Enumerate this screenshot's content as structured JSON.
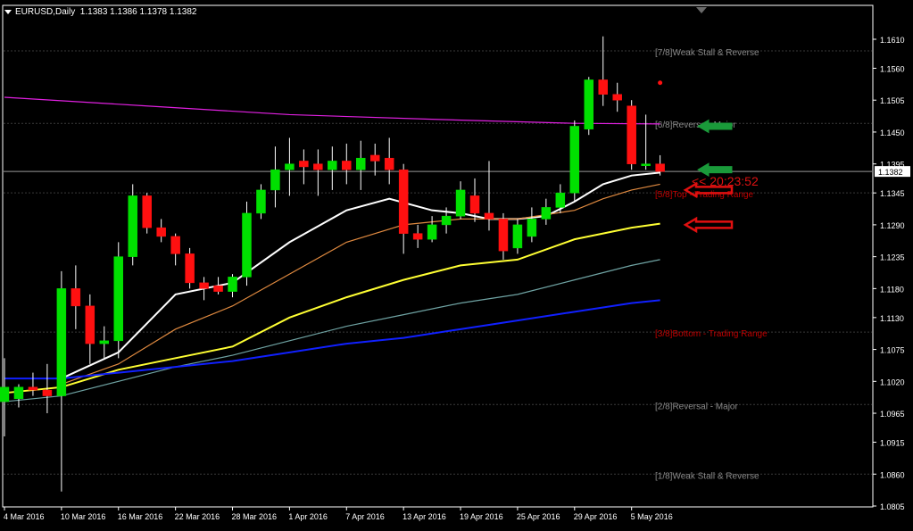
{
  "header": {
    "symbol": "EURUSD,Daily",
    "ohlc": "1.1383 1.1386 1.1378 1.1382"
  },
  "colors": {
    "background": "#000000",
    "frame": "#ffffff",
    "bull_candle": "#00e000",
    "bear_candle": "#ff1010",
    "wick": "#ffffff",
    "ema_white": "#ffffff",
    "ema_orange": "#e08a40",
    "ema_yellow": "#ffff33",
    "ema_teal": "#6fa3a3",
    "ema_blue": "#1020ff",
    "ema_magenta": "#e020e0",
    "murrey_line": "#3a3a3a",
    "murrey_text_grey": "#8a8a8a",
    "murrey_text_red": "#c00000",
    "price_line": "#9a9a9a",
    "arrow_green": "#1a9a3a",
    "arrow_red": "#e01010",
    "countdown": "#dd1111"
  },
  "chart_data": {
    "type": "candlestick",
    "symbol": "EURUSD",
    "timeframe": "Daily",
    "ylim": [
      1.08,
      1.164
    ],
    "y_ticks": [
      "1.1610",
      "1.1560",
      "1.1505",
      "1.1450",
      "1.1395",
      "1.1345",
      "1.1290",
      "1.1235",
      "1.1180",
      "1.1130",
      "1.1075",
      "1.1020",
      "1.0965",
      "1.0915",
      "1.0860",
      "1.0805"
    ],
    "x_tick_labels": [
      "4 Mar 2016",
      "10 Mar 2016",
      "16 Mar 2016",
      "22 Mar 2016",
      "28 Mar 2016",
      "1 Apr 2016",
      "7 Apr 2016",
      "13 Apr 2016",
      "19 Apr 2016",
      "25 Apr 2016",
      "29 Apr 2016",
      "5 May 2016"
    ],
    "x_tick_index": [
      0,
      4,
      8,
      12,
      16,
      20,
      24,
      28,
      32,
      36,
      40,
      44
    ],
    "candles": [
      {
        "o": 1.0985,
        "h": 1.106,
        "l": 1.0925,
        "c": 1.101
      },
      {
        "o": 1.099,
        "h": 1.1015,
        "l": 1.0975,
        "c": 1.101
      },
      {
        "o": 1.101,
        "h": 1.1035,
        "l": 1.0995,
        "c": 1.1005
      },
      {
        "o": 1.1005,
        "h": 1.105,
        "l": 1.0965,
        "c": 1.0995
      },
      {
        "o": 1.0995,
        "h": 1.121,
        "l": 1.083,
        "c": 1.118
      },
      {
        "o": 1.118,
        "h": 1.122,
        "l": 1.111,
        "c": 1.115
      },
      {
        "o": 1.115,
        "h": 1.117,
        "l": 1.105,
        "c": 1.1085
      },
      {
        "o": 1.1085,
        "h": 1.1115,
        "l": 1.106,
        "c": 1.109
      },
      {
        "o": 1.109,
        "h": 1.126,
        "l": 1.106,
        "c": 1.1235
      },
      {
        "o": 1.1235,
        "h": 1.136,
        "l": 1.122,
        "c": 1.134
      },
      {
        "o": 1.134,
        "h": 1.1345,
        "l": 1.1275,
        "c": 1.1285
      },
      {
        "o": 1.1285,
        "h": 1.13,
        "l": 1.126,
        "c": 1.127
      },
      {
        "o": 1.127,
        "h": 1.1275,
        "l": 1.122,
        "c": 1.124
      },
      {
        "o": 1.124,
        "h": 1.125,
        "l": 1.118,
        "c": 1.119
      },
      {
        "o": 1.119,
        "h": 1.12,
        "l": 1.116,
        "c": 1.118
      },
      {
        "o": 1.1185,
        "h": 1.12,
        "l": 1.117,
        "c": 1.1175
      },
      {
        "o": 1.1175,
        "h": 1.1205,
        "l": 1.1165,
        "c": 1.12
      },
      {
        "o": 1.12,
        "h": 1.133,
        "l": 1.1185,
        "c": 1.131
      },
      {
        "o": 1.131,
        "h": 1.136,
        "l": 1.13,
        "c": 1.135
      },
      {
        "o": 1.135,
        "h": 1.1425,
        "l": 1.132,
        "c": 1.1385
      },
      {
        "o": 1.1385,
        "h": 1.144,
        "l": 1.134,
        "c": 1.1395
      },
      {
        "o": 1.14,
        "h": 1.142,
        "l": 1.136,
        "c": 1.139
      },
      {
        "o": 1.1395,
        "h": 1.142,
        "l": 1.134,
        "c": 1.1385
      },
      {
        "o": 1.1385,
        "h": 1.1425,
        "l": 1.135,
        "c": 1.14
      },
      {
        "o": 1.14,
        "h": 1.143,
        "l": 1.136,
        "c": 1.1385
      },
      {
        "o": 1.1385,
        "h": 1.1435,
        "l": 1.135,
        "c": 1.1405
      },
      {
        "o": 1.141,
        "h": 1.143,
        "l": 1.1375,
        "c": 1.14
      },
      {
        "o": 1.1405,
        "h": 1.144,
        "l": 1.136,
        "c": 1.1385
      },
      {
        "o": 1.1385,
        "h": 1.1395,
        "l": 1.124,
        "c": 1.1275
      },
      {
        "o": 1.1275,
        "h": 1.129,
        "l": 1.125,
        "c": 1.1265
      },
      {
        "o": 1.1265,
        "h": 1.1305,
        "l": 1.126,
        "c": 1.129
      },
      {
        "o": 1.129,
        "h": 1.132,
        "l": 1.1275,
        "c": 1.1305
      },
      {
        "o": 1.1305,
        "h": 1.1365,
        "l": 1.13,
        "c": 1.135
      },
      {
        "o": 1.134,
        "h": 1.137,
        "l": 1.1295,
        "c": 1.131
      },
      {
        "o": 1.131,
        "h": 1.14,
        "l": 1.128,
        "c": 1.13
      },
      {
        "o": 1.13,
        "h": 1.131,
        "l": 1.123,
        "c": 1.1245
      },
      {
        "o": 1.125,
        "h": 1.13,
        "l": 1.124,
        "c": 1.129
      },
      {
        "o": 1.127,
        "h": 1.132,
        "l": 1.126,
        "c": 1.13
      },
      {
        "o": 1.13,
        "h": 1.1335,
        "l": 1.129,
        "c": 1.132
      },
      {
        "o": 1.132,
        "h": 1.136,
        "l": 1.131,
        "c": 1.1345
      },
      {
        "o": 1.1345,
        "h": 1.147,
        "l": 1.133,
        "c": 1.146
      },
      {
        "o": 1.1455,
        "h": 1.1545,
        "l": 1.1445,
        "c": 1.154
      },
      {
        "o": 1.154,
        "h": 1.1615,
        "l": 1.1495,
        "c": 1.1515
      },
      {
        "o": 1.1515,
        "h": 1.1535,
        "l": 1.1485,
        "c": 1.1505
      },
      {
        "o": 1.1495,
        "h": 1.1505,
        "l": 1.1385,
        "c": 1.1395
      },
      {
        "o": 1.1395,
        "h": 1.148,
        "l": 1.1385,
        "c": 1.1395
      },
      {
        "o": 1.1395,
        "h": 1.141,
        "l": 1.1375,
        "c": 1.1382
      }
    ],
    "series": [
      {
        "color": "#e020e0",
        "x": [
          0,
          10,
          20,
          30,
          40,
          46
        ],
        "y": [
          1.151,
          1.1495,
          1.148,
          1.1472,
          1.1465,
          1.1464
        ]
      },
      {
        "color": "#ffffff",
        "x": [
          4,
          8,
          12,
          16,
          20,
          24,
          27,
          30,
          32,
          34,
          36,
          38,
          40,
          42,
          44,
          46
        ],
        "y": [
          1.1025,
          1.107,
          1.117,
          1.119,
          1.126,
          1.1315,
          1.1335,
          1.1315,
          1.131,
          1.13,
          1.13,
          1.1305,
          1.133,
          1.136,
          1.1375,
          1.138
        ]
      },
      {
        "color": "#e08a40",
        "x": [
          4,
          8,
          12,
          16,
          20,
          24,
          28,
          32,
          36,
          40,
          42,
          44,
          46
        ],
        "y": [
          1.1015,
          1.105,
          1.111,
          1.115,
          1.1205,
          1.126,
          1.129,
          1.13,
          1.13,
          1.1315,
          1.1335,
          1.135,
          1.136
        ]
      },
      {
        "color": "#ffff33",
        "x": [
          0,
          4,
          8,
          12,
          16,
          20,
          24,
          28,
          32,
          36,
          40,
          44,
          46
        ],
        "y": [
          1.1,
          1.101,
          1.104,
          1.106,
          1.108,
          1.113,
          1.1165,
          1.1195,
          1.122,
          1.123,
          1.1265,
          1.1285,
          1.1292
        ]
      },
      {
        "color": "#6fa3a3",
        "x": [
          0,
          4,
          8,
          12,
          16,
          20,
          24,
          28,
          32,
          36,
          40,
          44,
          46
        ],
        "y": [
          1.0985,
          1.0995,
          1.102,
          1.1045,
          1.1065,
          1.109,
          1.1115,
          1.1135,
          1.1155,
          1.117,
          1.1195,
          1.122,
          1.123
        ]
      },
      {
        "color": "#1020ff",
        "x": [
          0,
          4,
          8,
          12,
          16,
          20,
          24,
          28,
          32,
          36,
          40,
          44,
          46
        ],
        "y": [
          1.1025,
          1.1025,
          1.1035,
          1.1045,
          1.1055,
          1.107,
          1.1085,
          1.1095,
          1.111,
          1.1125,
          1.114,
          1.1155,
          1.116
        ]
      }
    ],
    "murrey_levels": [
      {
        "label": "[7/8]Weak Stall & Reverse",
        "price": 1.159,
        "color": "#8a8a8a"
      },
      {
        "label": "[6/8]Reverse - Major",
        "price": 1.1465,
        "color": "#8a8a8a"
      },
      {
        "label": "[5/8]Top - Trading Range",
        "price": 1.1345,
        "color": "#c00000"
      },
      {
        "label": "[3/8]Bottom - Trading Range",
        "price": 1.1105,
        "color": "#c00000"
      },
      {
        "label": "[2/8]Reversal - Major",
        "price": 1.098,
        "color": "#8a8a8a"
      },
      {
        "label": "[1/8]Weak Stall & Reverse",
        "price": 1.086,
        "color": "#8a8a8a"
      }
    ],
    "current_price": {
      "value": 1.1382,
      "label": "1.1382"
    },
    "countdown": "<< 20:23:52",
    "arrows": [
      {
        "type": "green",
        "price": 1.146
      },
      {
        "type": "green",
        "price": 1.1385
      },
      {
        "type": "red",
        "price": 1.135
      },
      {
        "type": "red",
        "price": 1.129
      }
    ],
    "marker_dot": {
      "index": 46,
      "price": 1.1535
    }
  }
}
